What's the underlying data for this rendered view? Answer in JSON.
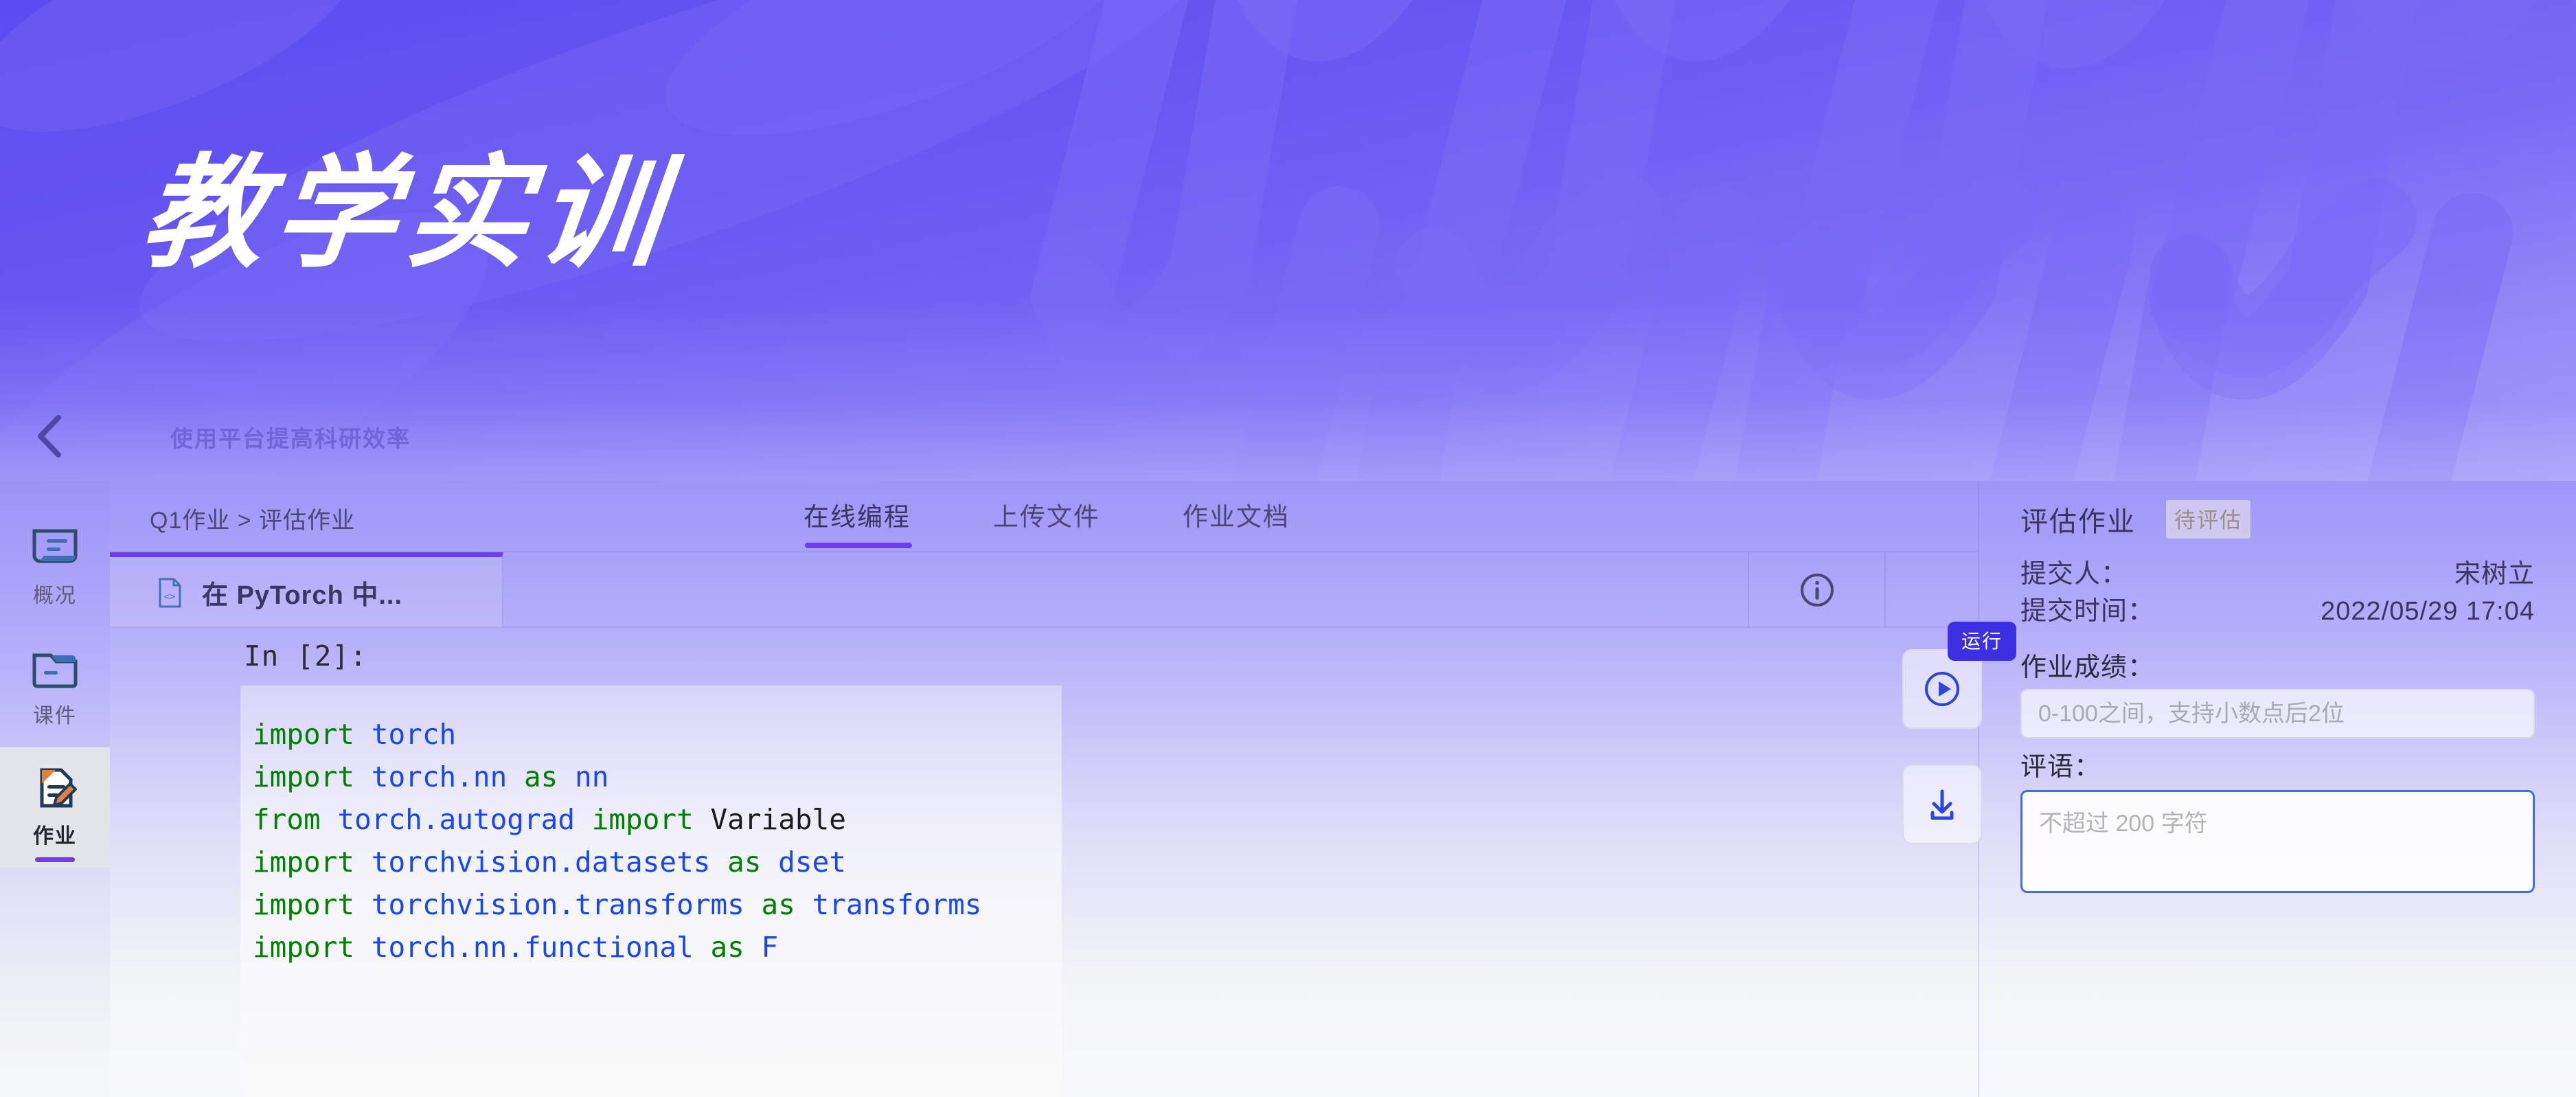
{
  "hero": {
    "title": "教学实训",
    "subtitle": "使用平台提高科研效率",
    "back_icon": "chevron-left-icon",
    "brand_color": "#6a5af2",
    "accent_color": "#6c3ef0"
  },
  "sidebar": {
    "items": [
      {
        "label": "概况",
        "icon": "overview-board-icon",
        "active": false
      },
      {
        "label": "课件",
        "icon": "folder-icon",
        "active": false
      },
      {
        "label": "作业",
        "icon": "homework-pencil-icon",
        "active": true
      }
    ]
  },
  "breadcrumb": {
    "text": "Q1作业 > 评估作业",
    "parent": "Q1作业",
    "separator": ">",
    "current": "评估作业"
  },
  "tabs": [
    {
      "label": "在线编程",
      "active": true
    },
    {
      "label": "上传文件",
      "active": false
    },
    {
      "label": "作业文档",
      "active": false
    }
  ],
  "file_tab": {
    "label": "在 PyTorch 中...",
    "icon": "code-file-icon",
    "info_icon": "info-circle-icon"
  },
  "editor": {
    "prompt": "In [2]:",
    "code_lines": [
      [
        {
          "t": "import ",
          "c": "kw"
        },
        {
          "t": "torch",
          "c": "mod"
        }
      ],
      [
        {
          "t": "import ",
          "c": "kw"
        },
        {
          "t": "torch.nn ",
          "c": "mod"
        },
        {
          "t": "as ",
          "c": "kw"
        },
        {
          "t": "nn",
          "c": "mod"
        }
      ],
      [
        {
          "t": "from ",
          "c": "kw"
        },
        {
          "t": "torch.autograd ",
          "c": "mod"
        },
        {
          "t": "import ",
          "c": "kw"
        },
        {
          "t": "Variable",
          "c": "pln"
        }
      ],
      [
        {
          "t": "import ",
          "c": "kw"
        },
        {
          "t": "torchvision.datasets ",
          "c": "mod"
        },
        {
          "t": "as ",
          "c": "kw"
        },
        {
          "t": "dset",
          "c": "mod"
        }
      ],
      [
        {
          "t": "import ",
          "c": "kw"
        },
        {
          "t": "torchvision.transforms ",
          "c": "mod"
        },
        {
          "t": "as ",
          "c": "kw"
        },
        {
          "t": "transforms",
          "c": "mod"
        }
      ],
      [
        {
          "t": "import ",
          "c": "kw"
        },
        {
          "t": "torch.nn.functional ",
          "c": "mod"
        },
        {
          "t": "as ",
          "c": "kw"
        },
        {
          "t": "F",
          "c": "mod"
        }
      ]
    ],
    "tools": {
      "run_tooltip": "运行",
      "run_icon": "play-circle-icon",
      "download_icon": "download-icon"
    }
  },
  "right_panel": {
    "title": "评估作业",
    "status_badge": "待评估",
    "rows": [
      {
        "key": "提交人：",
        "value": "宋树立"
      },
      {
        "key": "提交时间：",
        "value": "2022/05/29 17:04"
      }
    ],
    "score": {
      "label": "作业成绩：",
      "value": "",
      "placeholder": "0-100之间，支持小数点后2位"
    },
    "comment": {
      "label": "评语：",
      "value": "",
      "placeholder": "不超过 200 字符"
    }
  }
}
